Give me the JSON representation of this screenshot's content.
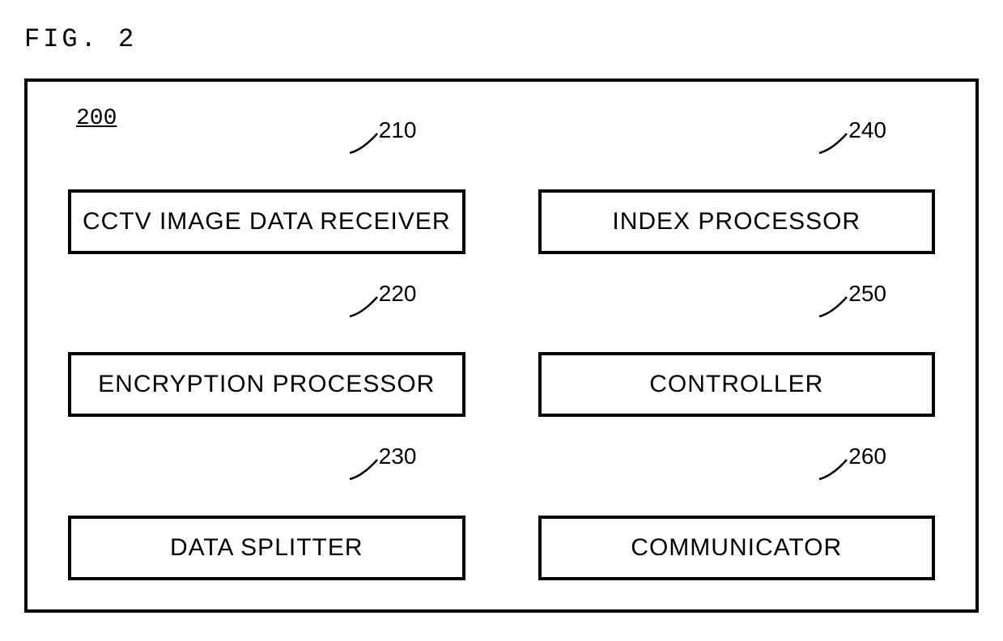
{
  "figureLabel": "FIG. 2",
  "moduleNumber": "200",
  "blocks": [
    {
      "ref": "210",
      "label": "CCTV IMAGE DATA RECEIVER"
    },
    {
      "ref": "240",
      "label": "INDEX PROCESSOR"
    },
    {
      "ref": "220",
      "label": "ENCRYPTION PROCESSOR"
    },
    {
      "ref": "250",
      "label": "CONTROLLER"
    },
    {
      "ref": "230",
      "label": "DATA SPLITTER"
    },
    {
      "ref": "260",
      "label": "COMMUNICATOR"
    }
  ]
}
